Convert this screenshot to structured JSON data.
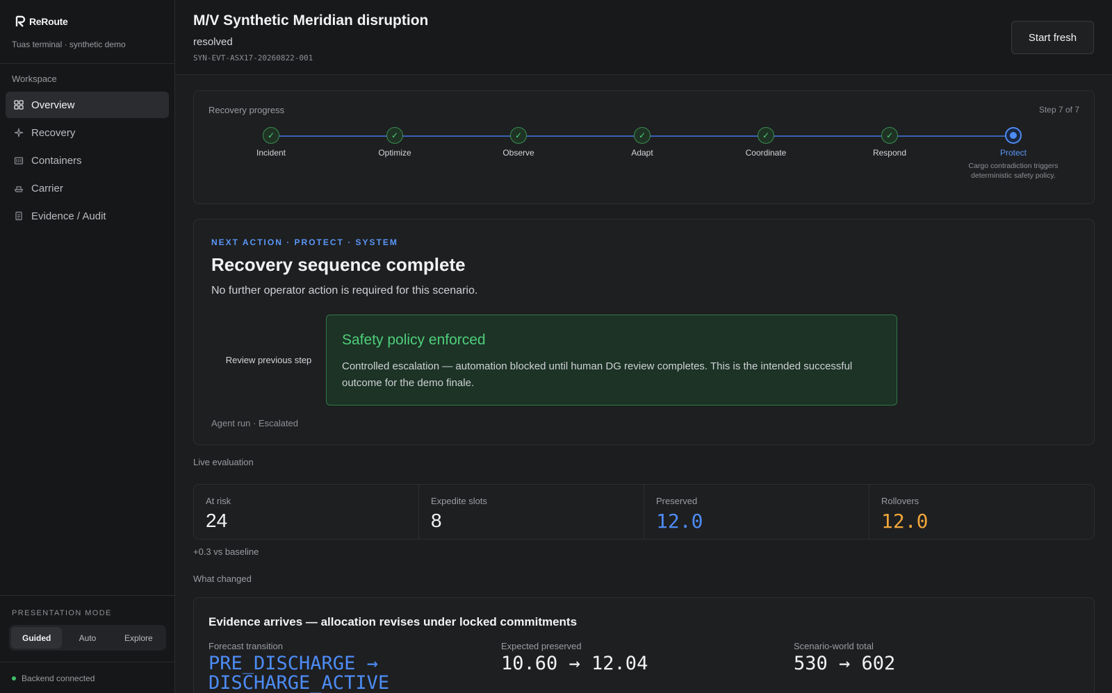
{
  "brand": {
    "name": "ReRoute",
    "subtitle": "Tuas terminal · synthetic demo"
  },
  "sidebar": {
    "section": "Workspace",
    "items": [
      {
        "label": "Overview",
        "icon": "grid-icon",
        "active": true
      },
      {
        "label": "Recovery",
        "icon": "sparkle-icon",
        "active": false
      },
      {
        "label": "Containers",
        "icon": "container-icon",
        "active": false
      },
      {
        "label": "Carrier",
        "icon": "ship-icon",
        "active": false
      },
      {
        "label": "Evidence / Audit",
        "icon": "document-icon",
        "active": false
      }
    ],
    "presentation_mode": {
      "label": "PRESENTATION MODE",
      "options": [
        "Guided",
        "Auto",
        "Explore"
      ],
      "selected": "Guided"
    },
    "status": "Backend connected"
  },
  "header": {
    "title": "M/V Synthetic Meridian disruption",
    "status": "resolved",
    "event_id": "SYN-EVT-ASX17-20260822-001",
    "start_button": "Start fresh"
  },
  "progress": {
    "label": "Recovery progress",
    "step_counter": "Step 7 of 7",
    "current_step": 7,
    "steps": [
      {
        "name": "Incident",
        "desc": ""
      },
      {
        "name": "Optimize",
        "desc": ""
      },
      {
        "name": "Observe",
        "desc": ""
      },
      {
        "name": "Adapt",
        "desc": ""
      },
      {
        "name": "Coordinate",
        "desc": ""
      },
      {
        "name": "Respond",
        "desc": ""
      },
      {
        "name": "Protect",
        "desc": "Cargo contradiction triggers deterministic safety policy."
      }
    ]
  },
  "next_action": {
    "eyebrow": "NEXT ACTION · PROTECT · SYSTEM",
    "title": "Recovery sequence complete",
    "description": "No further operator action is required for this scenario.",
    "review_button": "Review previous step",
    "safety": {
      "title": "Safety policy enforced",
      "body": "Controlled escalation — automation blocked until human DG review completes. This is the intended successful outcome for the demo finale."
    },
    "agent_run": "Agent run · Escalated"
  },
  "live_evaluation": {
    "label": "Live evaluation",
    "metrics": [
      {
        "label": "At risk",
        "value": "24"
      },
      {
        "label": "Expedite slots",
        "value": "8"
      },
      {
        "label": "Preserved",
        "value": "12.0"
      },
      {
        "label": "Rollovers",
        "value": "12.0"
      }
    ],
    "baseline": "+0.3 vs baseline",
    "colors": {
      "preserved": "#4d8cf5",
      "rollovers": "#f0a53a"
    }
  },
  "what_changed": {
    "label": "What changed",
    "title": "Evidence arrives — allocation revises under locked commitments",
    "columns": [
      {
        "label": "Forecast transition",
        "value": "PRE_DISCHARGE → DISCHARGE_ACTIVE"
      },
      {
        "label": "Expected preserved",
        "value": "10.60 → 12.04"
      },
      {
        "label": "Scenario-world total",
        "value": "530 → 602"
      }
    ]
  }
}
